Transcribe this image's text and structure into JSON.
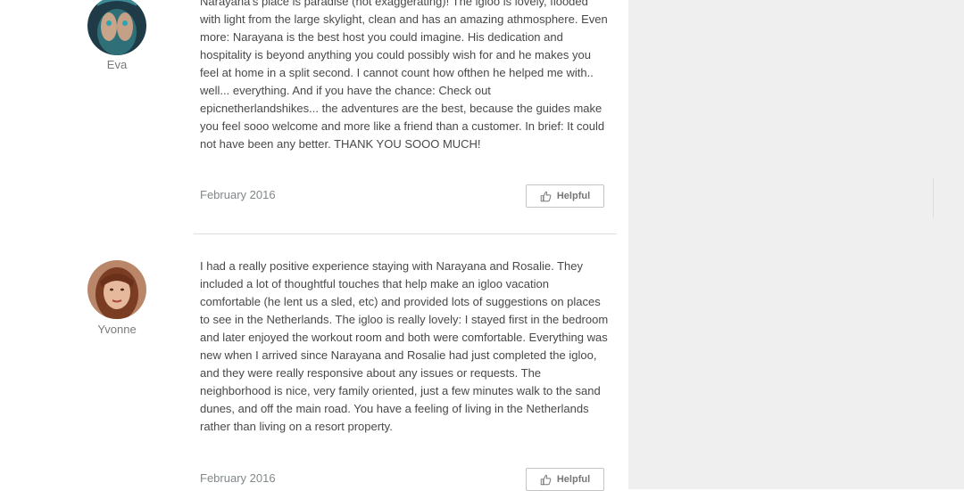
{
  "reviews": [
    {
      "name": "Eva",
      "text": "Narayana's place is paradise (not exaggerating)! The igloo is lovely, flooded with light from the large skylight, clean and has an amazing athmosphere. Even more: Narayana is the best host you could imagine. His dedication and hospitality is beyond anything you could possibly wish for and he makes you feel at home in a split second. I cannot count how ofthen he helped me with.. well... everything. And if you have the chance: Check out epicnetherlandshikes... the adventures are the best, because the guides make you feel sooo welcome and more like a friend than a customer. In brief: It could not have been any better. THANK YOU SOOO MUCH!",
      "date": "February 2016",
      "helpful_label": "Helpful"
    },
    {
      "name": "Yvonne",
      "text": "I had a really positive experience staying with Narayana and Rosalie. They included a lot of thoughtful touches that help make an igloo vacation comfortable (he lent us a sled, etc) and provided lots of suggestions on places to see in the Netherlands. The igloo is really lovely: I stayed first in the bedroom and later enjoyed the workout room and both were comfortable. Everything was new when I arrived since Narayana and Rosalie had just completed the igloo, and they were really responsive about any issues or requests. The neighborhood is nice, very family oriented, just a few minutes walk to the sand dunes, and off the main road. You have a feeling of living in the Netherlands rather than living on a resort property.",
      "date": "February 2016",
      "helpful_label": "Helpful"
    }
  ],
  "colors": {
    "sidebar_bg": "#efefef",
    "text": "#484848",
    "muted": "#82888a"
  }
}
